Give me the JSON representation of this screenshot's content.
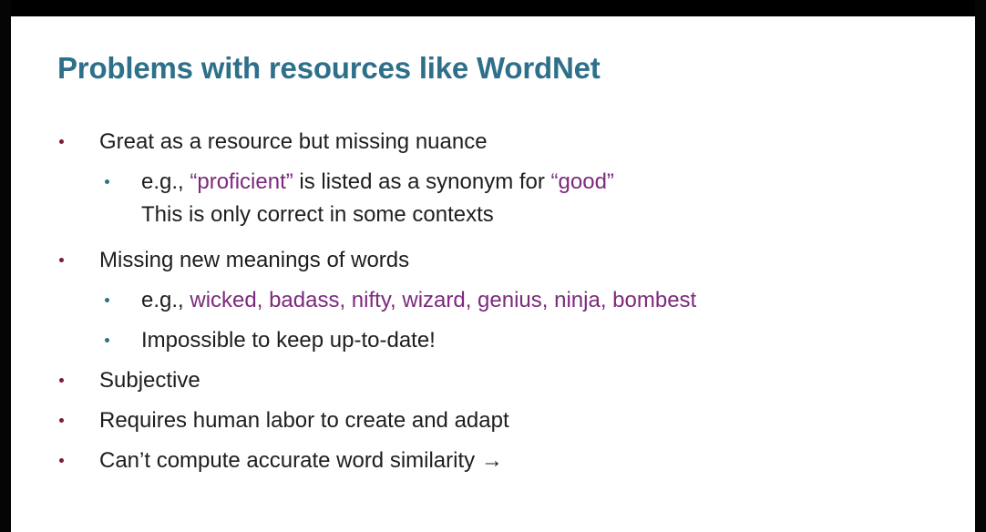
{
  "slide": {
    "title": "Problems with resources like WordNet",
    "bullets": {
      "b1": "Great as a resource but missing nuance",
      "b1_sub1": {
        "prefix": "e.g., ",
        "term1": "“proficient”",
        "middle": " is listed as a synonym for ",
        "term2": "“good”"
      },
      "b1_sub1_cont": "This is only correct in some contexts",
      "b2": "Missing new meanings of words",
      "b2_sub1": {
        "prefix": "e.g., ",
        "terms": "wicked, badass, nifty, wizard, genius, ninja, bombest"
      },
      "b2_sub2": "Impossible to keep up-to-date!",
      "b3": "Subjective",
      "b4": "Requires human labor to create and adapt",
      "b5": "Can’t compute accurate word similarity →"
    }
  },
  "colors": {
    "title": "#2e6f8a",
    "highlight": "#7c2a7c",
    "bullet_level1": "#7a1e2e",
    "bullet_level2": "#2e6f8a"
  }
}
